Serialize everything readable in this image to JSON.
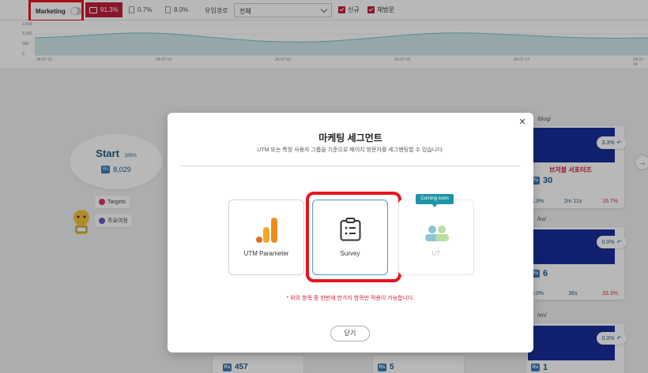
{
  "filters": {
    "marketing_label": "Marketing",
    "marketing_toggle": "off",
    "devices": [
      {
        "name": "desktop",
        "value": "91.3%",
        "active": true
      },
      {
        "name": "tablet",
        "value": "0.7%",
        "active": false
      },
      {
        "name": "mobile",
        "value": "8.0%",
        "active": false
      }
    ],
    "inflow_label": "유입경로",
    "inflow_value": "전체",
    "new_label": "신규",
    "returning_label": "재방문"
  },
  "trend": {
    "y_ticks": [
      "2,000",
      "1,000",
      "500",
      "0"
    ],
    "x_ticks": [
      "24-07-13",
      "24-07-14",
      "24-07-15",
      "24-07-16",
      "24-07-17",
      "24-07-18"
    ]
  },
  "background": {
    "start_title": "Start",
    "start_pct": "100%",
    "start_count": "8,029",
    "rs_label": "Rs",
    "targets_label": "Targets",
    "main_path_label": "주요여정",
    "cards": [
      {
        "url": "/blog/",
        "pct": "3.3%",
        "count": "30",
        "banner_text": "브저블 서포터즈",
        "stats": [
          "3.3%",
          "2m 11s",
          "16.7%"
        ]
      },
      {
        "url": "/ko/",
        "pct": "0.0%",
        "count": "6",
        "stats": [
          "0.0%",
          "36s",
          "33.3%"
        ]
      },
      {
        "url": "/en/",
        "pct": "0.0%",
        "count": "1"
      }
    ],
    "bottom_counts": [
      "457",
      "5"
    ]
  },
  "modal": {
    "title": "마케팅 세그먼트",
    "subtitle": "UTM 또는 특정 사용자 그룹을 기준으로 페이지 방문자를 세그멘팅할 수 있습니다.",
    "options": [
      {
        "label": "UTM Parameter",
        "icon": "bar-chart-icon",
        "enabled": true
      },
      {
        "label": "Survey",
        "icon": "clipboard-icon",
        "enabled": true,
        "selected": true
      },
      {
        "label": "UT",
        "icon": "users-icon",
        "enabled": false,
        "badge": "Coming soon"
      }
    ],
    "notice": "* 위의 항목 중 한번에 한가지 항목만 적용이 가능합니다.",
    "close_label": "닫기"
  },
  "colors": {
    "accent_red": "#c0203a",
    "brand_blue": "#1d5d8a",
    "chart_fill": "#cfe8ea",
    "coming_soon_teal": "#1f94a6",
    "utm_orange": "#f08a1c"
  }
}
